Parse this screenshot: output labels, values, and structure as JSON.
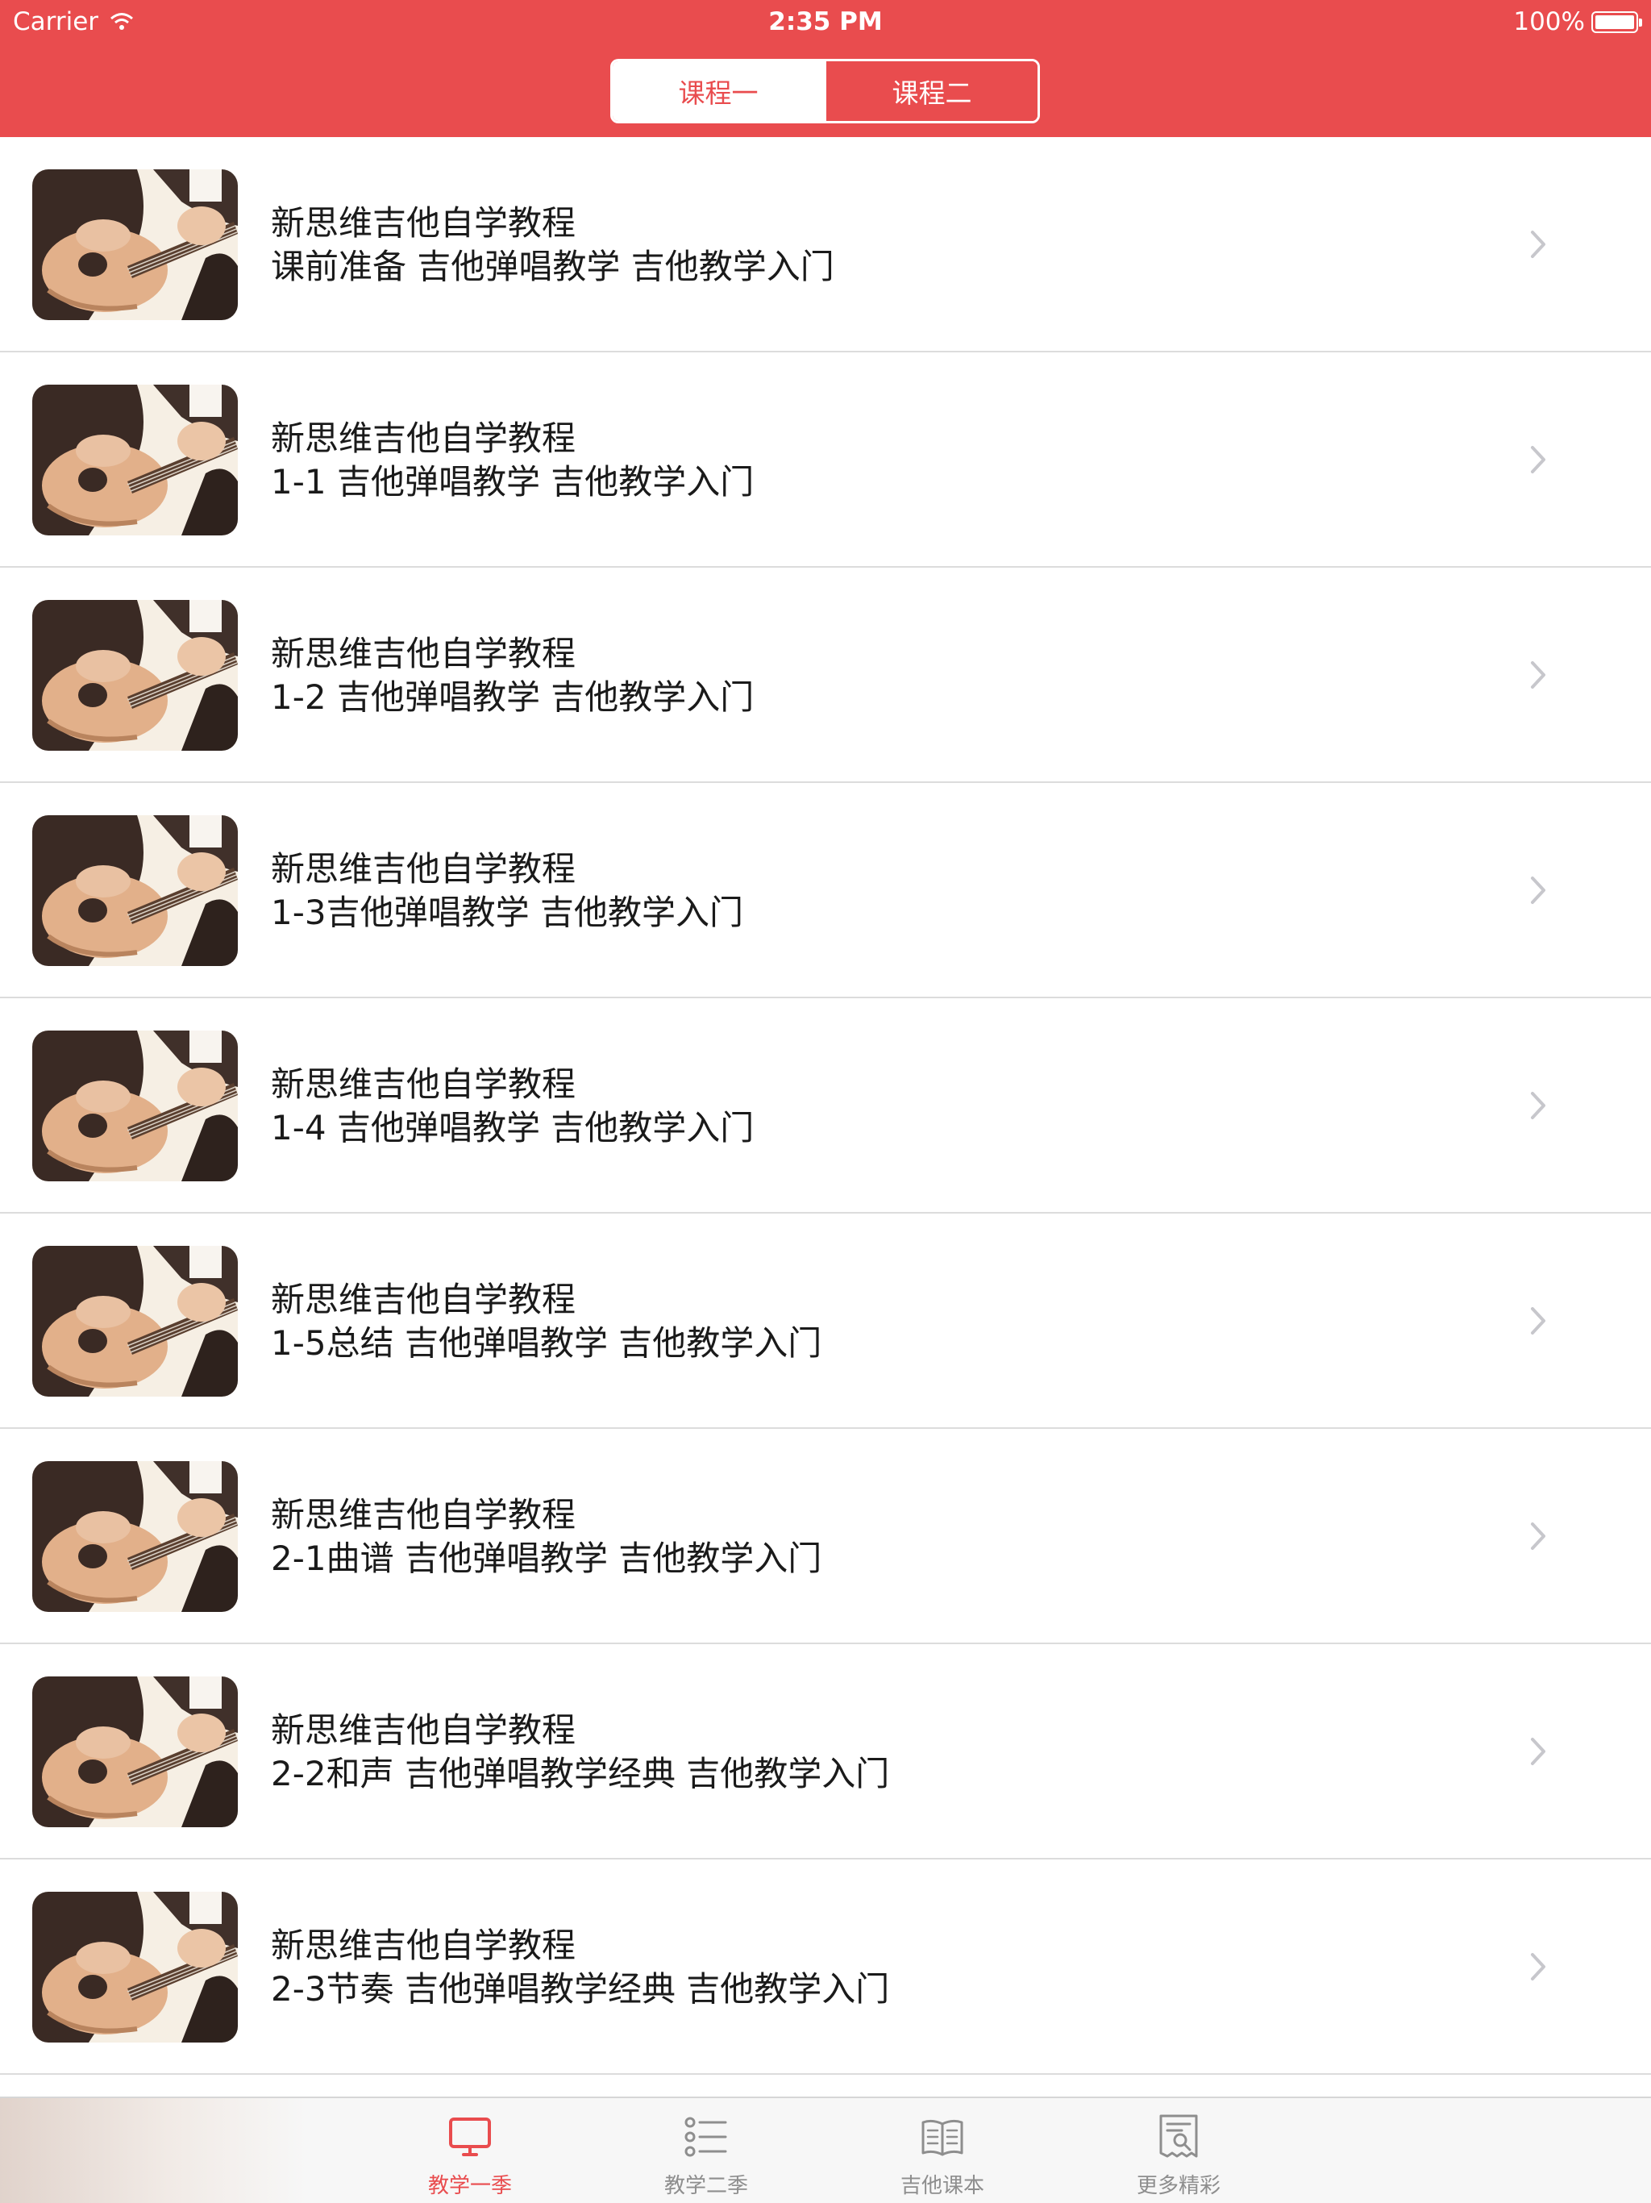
{
  "status_bar": {
    "carrier": "Carrier",
    "time": "2:35 PM",
    "battery": "100%"
  },
  "segmented_control": {
    "tabs": [
      {
        "label": "课程一",
        "selected": true
      },
      {
        "label": "课程二",
        "selected": false
      }
    ]
  },
  "list": {
    "items": [
      {
        "title": "新思维吉他自学教程",
        "subtitle": "课前准备 吉他弹唱教学 吉他教学入门"
      },
      {
        "title": "新思维吉他自学教程",
        "subtitle": "1-1 吉他弹唱教学 吉他教学入门"
      },
      {
        "title": "新思维吉他自学教程",
        "subtitle": "1-2 吉他弹唱教学 吉他教学入门"
      },
      {
        "title": "新思维吉他自学教程",
        "subtitle": "1-3吉他弹唱教学 吉他教学入门"
      },
      {
        "title": "新思维吉他自学教程",
        "subtitle": "1-4 吉他弹唱教学 吉他教学入门"
      },
      {
        "title": "新思维吉他自学教程",
        "subtitle": "1-5总结 吉他弹唱教学 吉他教学入门"
      },
      {
        "title": "新思维吉他自学教程",
        "subtitle": "2-1曲谱 吉他弹唱教学 吉他教学入门"
      },
      {
        "title": "新思维吉他自学教程",
        "subtitle": "2-2和声 吉他弹唱教学经典 吉他教学入门"
      },
      {
        "title": "新思维吉他自学教程",
        "subtitle": "2-3节奏 吉他弹唱教学经典 吉他教学入门"
      }
    ]
  },
  "tab_bar": {
    "tabs": [
      {
        "label": "教学一季",
        "icon": "monitor-icon",
        "active": true
      },
      {
        "label": "教学二季",
        "icon": "list-icon",
        "active": false
      },
      {
        "label": "吉他课本",
        "icon": "book-icon",
        "active": false
      },
      {
        "label": "更多精彩",
        "icon": "receipt-search-icon",
        "active": false
      }
    ]
  },
  "colors": {
    "accent": "#e94c4e",
    "inactive": "#8e8e8e",
    "separator": "#dcdcdc"
  }
}
